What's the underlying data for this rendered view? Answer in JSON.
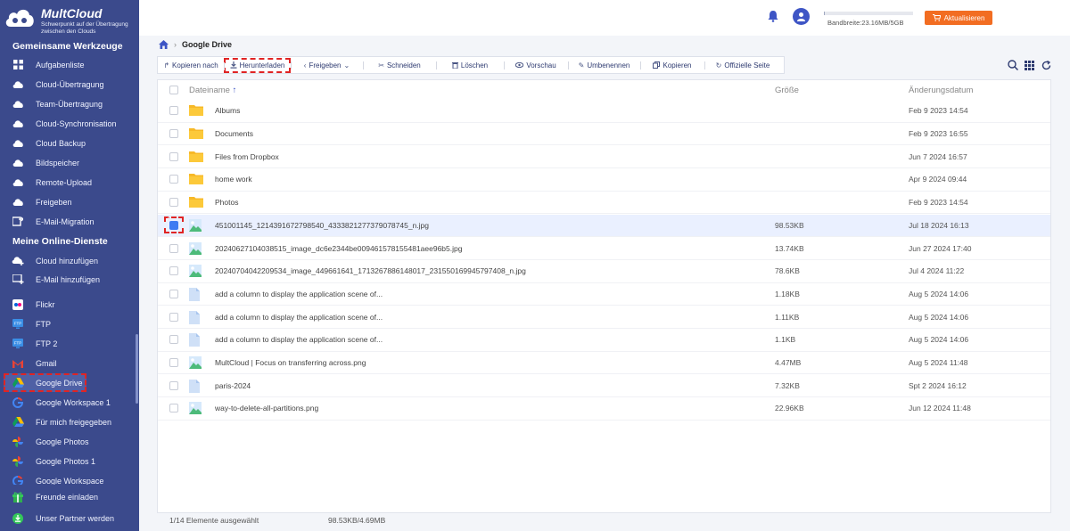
{
  "app": {
    "logo_title": "MultCloud",
    "logo_subtitle": "Schwerpunkt auf der Übertragung zwischen den Clouds"
  },
  "sidebar": {
    "section1_title": "Gemeinsame Werkzeuge",
    "section1_items": [
      {
        "label": "Aufgabenliste",
        "icon": "grid-icon"
      },
      {
        "label": "Cloud-Übertragung",
        "icon": "cloud-transfer-icon"
      },
      {
        "label": "Team-Übertragung",
        "icon": "team-transfer-icon"
      },
      {
        "label": "Cloud-Synchronisation",
        "icon": "cloud-sync-icon"
      },
      {
        "label": "Cloud Backup",
        "icon": "cloud-backup-icon"
      },
      {
        "label": "Bildspeicher",
        "icon": "image-saver-icon"
      },
      {
        "label": "Remote-Upload",
        "icon": "remote-upload-icon"
      },
      {
        "label": "Freigeben",
        "icon": "share-icon"
      },
      {
        "label": "E-Mail-Migration",
        "icon": "email-migration-icon"
      }
    ],
    "section2_title": "Meine Online-Dienste",
    "section2_items": [
      {
        "label": "Cloud hinzufügen",
        "icon": "add-cloud-icon"
      },
      {
        "label": "E-Mail hinzufügen",
        "icon": "add-email-icon"
      },
      {
        "label": "Flickr",
        "icon": "flickr-icon"
      },
      {
        "label": "FTP",
        "icon": "ftp-icon"
      },
      {
        "label": "FTP 2",
        "icon": "ftp-icon"
      },
      {
        "label": "Gmail",
        "icon": "gmail-icon"
      },
      {
        "label": "Google Drive",
        "icon": "google-drive-icon"
      },
      {
        "label": "Google Workspace 1",
        "icon": "google-workspace-icon"
      },
      {
        "label": "Für mich freigegeben",
        "icon": "shared-with-me-icon"
      },
      {
        "label": "Google Photos",
        "icon": "google-photos-icon"
      },
      {
        "label": "Google Photos 1",
        "icon": "google-photos-icon"
      },
      {
        "label": "Google Workspace",
        "icon": "google-workspace-icon"
      }
    ],
    "bottom_items": [
      {
        "label": "Freunde einladen",
        "icon": "invite-friends-icon"
      },
      {
        "label": "Unser Partner werden",
        "icon": "partner-icon"
      }
    ]
  },
  "header": {
    "bandwidth": "Bandbreite:23.16MB/5GB",
    "upgrade_label": "Aktualisieren",
    "bandwidth_used_fraction": 0.005
  },
  "breadcrumb": {
    "current": "Google Drive"
  },
  "toolbar": {
    "copy_to": "Kopieren nach",
    "download": "Herunterladen",
    "share": "Freigeben",
    "cut": "Schneiden",
    "delete": "Löschen",
    "preview": "Vorschau",
    "rename": "Umbenennen",
    "copy": "Kopieren",
    "official_site": "Offizielle Seite"
  },
  "table": {
    "col_name": "Dateiname",
    "col_size": "Größe",
    "col_date": "Änderungsdatum",
    "rows": [
      {
        "name": "Albums",
        "size": "",
        "date": "Feb 9 2023 14:54",
        "type": "folder",
        "checked": false
      },
      {
        "name": "Documents",
        "size": "",
        "date": "Feb 9 2023 16:55",
        "type": "folder",
        "checked": false
      },
      {
        "name": "Files from Dropbox",
        "size": "",
        "date": "Jun 7 2024 16:57",
        "type": "folder",
        "checked": false
      },
      {
        "name": "home work",
        "size": "",
        "date": "Apr 9 2024 09:44",
        "type": "folder",
        "checked": false
      },
      {
        "name": "Photos",
        "size": "",
        "date": "Feb 9 2023 14:54",
        "type": "folder",
        "checked": false
      },
      {
        "name": "451001145_1214391672798540_4333821277379078745_n.jpg",
        "size": "98.53KB",
        "date": "Jul 18 2024 16:13",
        "type": "image",
        "checked": true
      },
      {
        "name": "20240627104038515_image_dc6e2344be009461578155481aee96b5.jpg",
        "size": "13.74KB",
        "date": "Jun 27 2024 17:40",
        "type": "image",
        "checked": false
      },
      {
        "name": "20240704042209534_image_449661641_1713267886148017_2315501699457974​08_n.jpg",
        "size": "78.6KB",
        "date": "Jul 4 2024 11:22",
        "type": "image",
        "checked": false
      },
      {
        "name": "add a column to display the application scene of...",
        "size": "1.18KB",
        "date": "Aug 5 2024 14:06",
        "type": "file",
        "checked": false
      },
      {
        "name": "add a column to display the application scene of...",
        "size": "1.11KB",
        "date": "Aug 5 2024 14:06",
        "type": "file",
        "checked": false
      },
      {
        "name": "add a column to display the application scene of...",
        "size": "1.1KB",
        "date": "Aug 5 2024 14:06",
        "type": "file",
        "checked": false
      },
      {
        "name": "MultCloud | Focus on transferring across.png",
        "size": "4.47MB",
        "date": "Aug 5 2024 11:48",
        "type": "image",
        "checked": false
      },
      {
        "name": "paris-2024",
        "size": "7.32KB",
        "date": "Spt 2 2024 16:12",
        "type": "file",
        "checked": false
      },
      {
        "name": "way-to-delete-all-partitions.png",
        "size": "22.96KB",
        "date": "Jun 12 2024 11:48",
        "type": "image",
        "checked": false
      }
    ]
  },
  "status": {
    "selected": "1/14 Elemente ausgewählt",
    "size": "98.53KB/4.69MB"
  },
  "colors": {
    "sidebar_bg": "#3b4a8c",
    "accent": "#3e55c5",
    "upgrade": "#f26d22",
    "highlight": "#e02424"
  }
}
